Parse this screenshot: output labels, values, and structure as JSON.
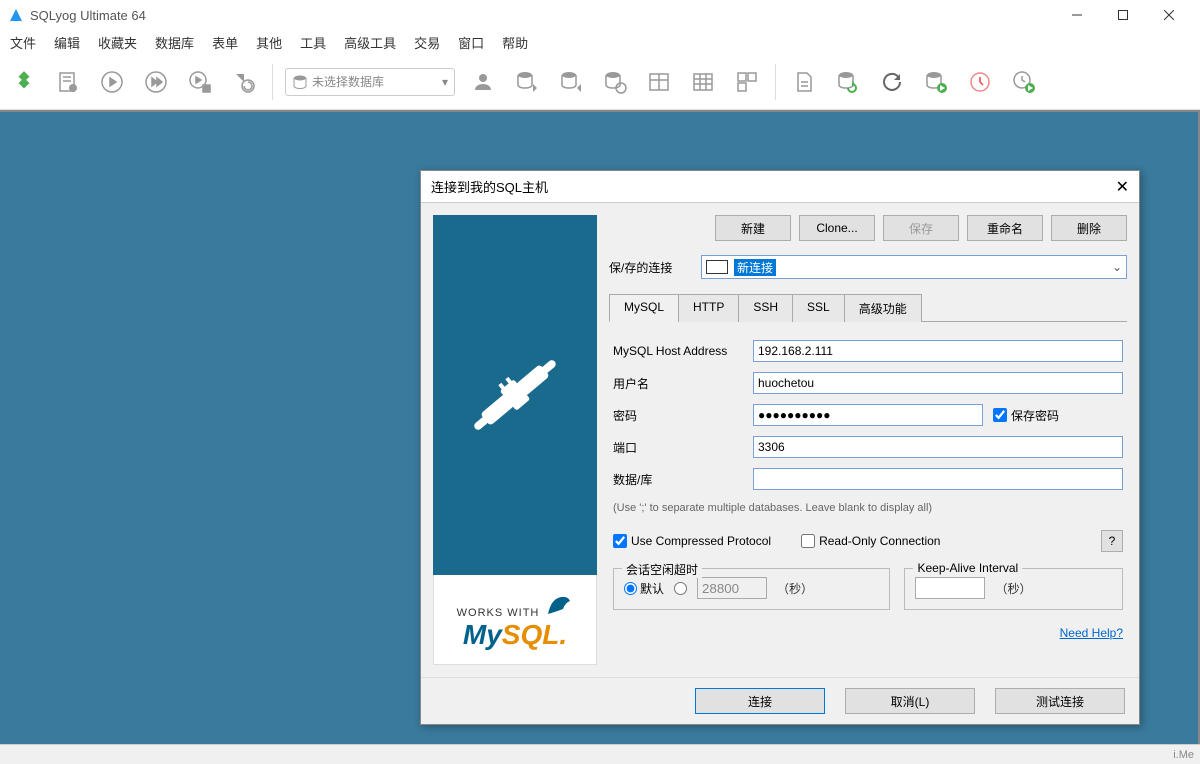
{
  "titlebar": {
    "title": "SQLyog Ultimate 64"
  },
  "menu": {
    "items": [
      "文件",
      "编辑",
      "收藏夹",
      "数据库",
      "表单",
      "其他",
      "工具",
      "高级工具",
      "交易",
      "窗口",
      "帮助"
    ]
  },
  "toolbar": {
    "db_placeholder": "未选择数据库"
  },
  "dialog": {
    "title": "连接到我的SQL主机",
    "buttons": {
      "new": "新建",
      "clone": "Clone...",
      "save": "保存",
      "rename": "重命名",
      "delete": "删除"
    },
    "saved": {
      "label": "保/存的连接",
      "value": "新连接"
    },
    "tabs": [
      "MySQL",
      "HTTP",
      "SSH",
      "SSL",
      "高级功能"
    ],
    "form": {
      "host_label": "MySQL Host Address",
      "host": "192.168.2.111",
      "user_label": "用户名",
      "user": "huochetou",
      "pass_label": "密码",
      "pass": "●●●●●●●●●●",
      "save_pass": "保存密码",
      "port_label": "端口",
      "port": "3306",
      "db_label": "数据/库",
      "db": "",
      "hint": "(Use ';' to separate multiple databases. Leave blank to display all)",
      "compressed": "Use Compressed Protocol",
      "readonly": "Read-Only Connection",
      "help_q": "?",
      "idle_title": "会话空闲超时",
      "default_radio": "默认",
      "idle_value": "28800",
      "seconds": "（秒）",
      "keepalive_title": "Keep-Alive Interval",
      "keepalive_value": "",
      "need_help": "Need Help?"
    },
    "footer": {
      "connect": "连接",
      "cancel": "取消(L)",
      "test": "测试连接"
    },
    "logo": {
      "works": "WORKS WITH",
      "my": "My",
      "sql": "SQL"
    }
  },
  "statusbar": {
    "text": "i.Me"
  }
}
